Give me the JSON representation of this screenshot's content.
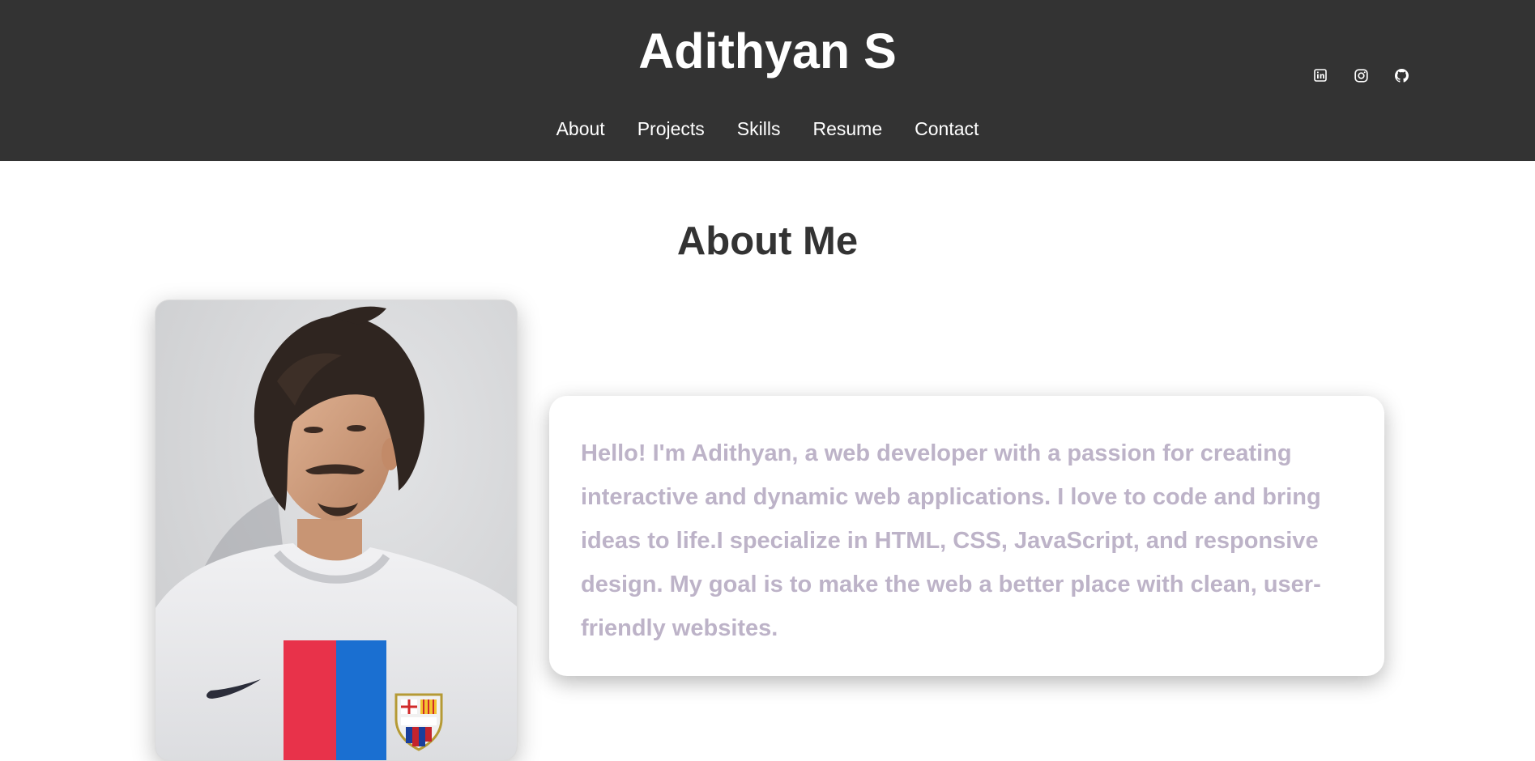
{
  "header": {
    "title": "Adithyan S",
    "nav": [
      {
        "label": "About"
      },
      {
        "label": "Projects"
      },
      {
        "label": "Skills"
      },
      {
        "label": "Resume"
      },
      {
        "label": "Contact"
      }
    ],
    "social_icons": [
      "linkedin-icon",
      "instagram-icon",
      "github-icon"
    ],
    "background": "#333333"
  },
  "about": {
    "heading": "About Me",
    "text": "Hello! I'm Adithyan, a web developer with a passion for creating interactive and dynamic web applications. I love to code and bring ideas to life.I specialize in HTML, CSS, JavaScript, and responsive design. My goal is to make the web a better place with clean, user-friendly websites.",
    "text_color": "#bdb3c8"
  }
}
